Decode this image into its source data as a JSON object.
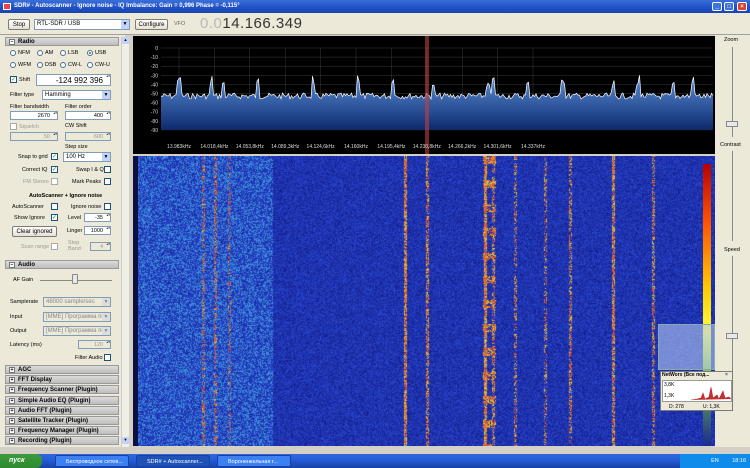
{
  "window": {
    "title": "SDR# - Autoscanner - Ignore noise - IQ Imbalance: Gain = 0,996 Phase = -0,115°"
  },
  "toolbar": {
    "play_label": "Stop",
    "source": "RTL-SDR / USB",
    "configure_label": "Configure",
    "vfo_label": "VFO",
    "vfo_dim": "0.0",
    "vfo_value": "14.166.349"
  },
  "radio": {
    "section": "Radio",
    "modes": [
      "NFM",
      "AM",
      "LSB",
      "USB",
      "WFM",
      "DSB",
      "CW-L",
      "CW-U"
    ],
    "selected_mode": "USB",
    "shift_label": "Shift",
    "shift_value": "-124 992 396",
    "filter_type_label": "Filter type",
    "filter_type": "Hamming",
    "filter_bw_label": "Filter bandwidth",
    "filter_bw": "2670",
    "filter_order_label": "Filter order",
    "filter_order": "400",
    "squelch_label": "Squelch",
    "squelch_value": "50",
    "cw_shift_label": "CW Shift",
    "cw_shift": "600",
    "step_size_label": "Step size",
    "step_size": "100 Hz",
    "snap_label": "Snap to grid",
    "correct_iq_label": "Correct IQ",
    "swap_iq_label": "Swap I & Q",
    "fm_stereo_label": "FM Stereo",
    "mark_peaks_label": "Mark Peaks"
  },
  "autoscanner": {
    "title": "AutoScanner + Ignore noise",
    "autoscanner_label": "AutoScanner",
    "ignore_noise_label": "Ignore noise",
    "show_ignore_label": "Show Ignore",
    "level_label": "Level",
    "level_value": "-35",
    "clear_ignored_label": "Clear ignored",
    "linger_label": "Linger",
    "linger_value": "1000",
    "scan_range_label": "Scan range",
    "step_band_label": "Step Band",
    "step_band_value": "4"
  },
  "audio": {
    "section": "Audio",
    "af_gain_label": "AF Gain",
    "samplerate_label": "Samplerate",
    "samplerate": "48000 sample/sec",
    "input_label": "Input",
    "input": "[MME] Программа пе",
    "output_label": "Output",
    "output": "[MME] Программа пе",
    "latency_label": "Latency (ms)",
    "latency": "120",
    "filter_audio_label": "Filter Audio"
  },
  "plugins": [
    "AGC",
    "FFT Display",
    "Frequency Scanner (Plugin)",
    "Simple Audio EQ (Plugin)",
    "Audio FFT (Plugin)",
    "Satellite Tracker (Plugin)",
    "Frequency Manager (Plugin)",
    "Recording (Plugin)"
  ],
  "spectrum": {
    "db_ticks": [
      "0",
      "-10",
      "-20",
      "-30",
      "-40",
      "-50",
      "-60",
      "-70",
      "-80",
      "-90"
    ],
    "freq_ticks": [
      "13.983kHz",
      "14.018,4kHz",
      "14.053,8kHz",
      "14.089,3kHz",
      "14.124,6kHz",
      "14.160kHz",
      "14.195,4kHz",
      "14.230,8kHz",
      "14.266,2kHz",
      "14.301,6kHz",
      "14.337kHz"
    ]
  },
  "right_panel": {
    "zoom_label": "Zoom",
    "contrast_label": "Contrast",
    "speed_label": "Speed"
  },
  "networx": {
    "title": "NetWorx (Все под...",
    "val1": "3,8K",
    "val2": "1,3K",
    "down": "D: 278",
    "up": "U: 1,3K"
  },
  "taskbar": {
    "start": "пуск",
    "tasks": [
      "Беспроводное сетев...",
      "SDR# + Autoscanner...",
      "Вороненкельная г..."
    ],
    "clock": "18:16",
    "lang": "EN"
  }
}
